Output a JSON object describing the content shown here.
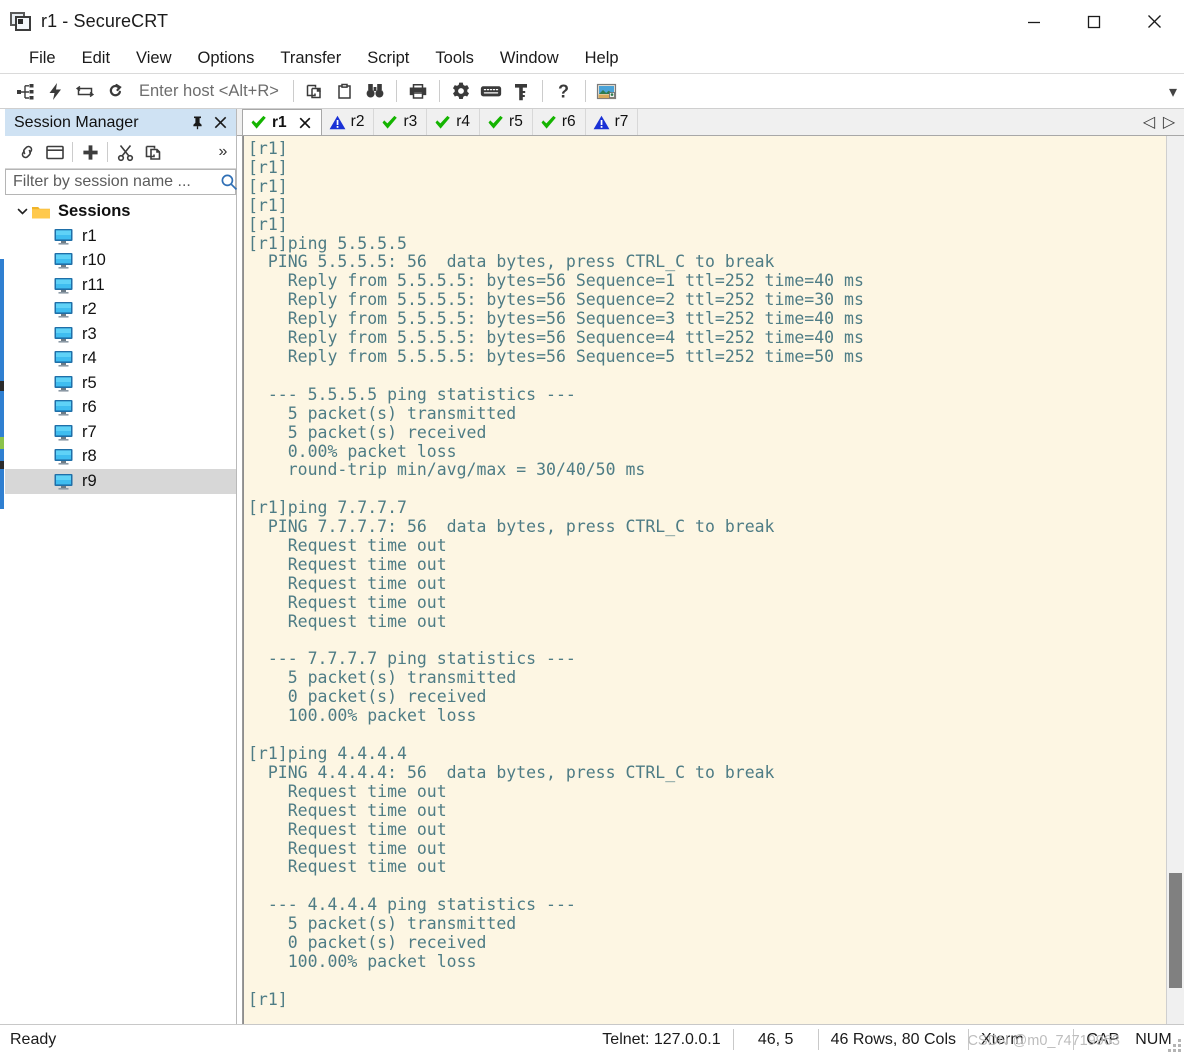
{
  "window": {
    "title": "r1 - SecureCRT",
    "app_icon": "securecrt-icon",
    "minimize_label": "Minimize",
    "maximize_label": "Maximize",
    "close_label": "Close"
  },
  "menubar": {
    "items": [
      {
        "label": "File"
      },
      {
        "label": "Edit"
      },
      {
        "label": "View"
      },
      {
        "label": "Options"
      },
      {
        "label": "Transfer"
      },
      {
        "label": "Script"
      },
      {
        "label": "Tools"
      },
      {
        "label": "Window"
      },
      {
        "label": "Help"
      }
    ]
  },
  "toolbar": {
    "host_entry": "Enter host <Alt+R>",
    "buttons": [
      {
        "name": "connect-icon",
        "title": "Connect"
      },
      {
        "name": "quick-connect-icon",
        "title": "Quick Connect"
      },
      {
        "name": "connect-in-tab-icon",
        "title": "Connect in Tab"
      },
      {
        "name": "reconnect-icon",
        "title": "Reconnect"
      },
      {
        "name": "copy-icon",
        "title": "Copy"
      },
      {
        "name": "paste-icon",
        "title": "Paste"
      },
      {
        "name": "find-icon",
        "title": "Find"
      },
      {
        "name": "print-icon",
        "title": "Print"
      },
      {
        "name": "gear-icon",
        "title": "Session Options"
      },
      {
        "name": "keyboard-icon",
        "title": "Keymap Editor"
      },
      {
        "name": "key-icon",
        "title": "Public Key"
      },
      {
        "name": "help-icon",
        "title": "Help"
      },
      {
        "name": "secure-image-icon",
        "title": "SecureFX"
      }
    ],
    "overflow_label": "▾"
  },
  "session_manager": {
    "title": "Session Manager",
    "pin_label": "⚐",
    "close_label": "✕",
    "toolbar_buttons": [
      {
        "name": "connect-session-icon",
        "title": "Connect"
      },
      {
        "name": "new-window-icon",
        "title": "Connect in New Window"
      },
      {
        "name": "new-session-icon",
        "title": "New Session"
      },
      {
        "name": "cut-icon",
        "title": "Cut"
      },
      {
        "name": "copy-session-icon",
        "title": "Copy"
      }
    ],
    "overflow_label": "»",
    "filter_placeholder": "Filter by session name ...",
    "filter_value": "",
    "tree": {
      "root_label": "Sessions",
      "root_expanded": true,
      "items": [
        {
          "label": "r1",
          "selected": false
        },
        {
          "label": "r10",
          "selected": false
        },
        {
          "label": "r11",
          "selected": false
        },
        {
          "label": "r2",
          "selected": false
        },
        {
          "label": "r3",
          "selected": false
        },
        {
          "label": "r4",
          "selected": false
        },
        {
          "label": "r5",
          "selected": false
        },
        {
          "label": "r6",
          "selected": false
        },
        {
          "label": "r7",
          "selected": false
        },
        {
          "label": "r8",
          "selected": false
        },
        {
          "label": "r9",
          "selected": true
        }
      ]
    }
  },
  "tabs": {
    "items": [
      {
        "label": "r1",
        "status": "connected",
        "icon": "green-check-icon",
        "active": true,
        "closable": true
      },
      {
        "label": "r2",
        "status": "warning",
        "icon": "blue-warning-icon",
        "active": false,
        "closable": false
      },
      {
        "label": "r3",
        "status": "connected",
        "icon": "green-check-icon",
        "active": false,
        "closable": false
      },
      {
        "label": "r4",
        "status": "connected",
        "icon": "green-check-icon",
        "active": false,
        "closable": false
      },
      {
        "label": "r5",
        "status": "connected",
        "icon": "green-check-icon",
        "active": false,
        "closable": false
      },
      {
        "label": "r6",
        "status": "connected",
        "icon": "green-check-icon",
        "active": false,
        "closable": false
      },
      {
        "label": "r7",
        "status": "warning",
        "icon": "blue-warning-icon",
        "active": false,
        "closable": false
      }
    ],
    "nav_prev": "◁",
    "nav_next": "▷"
  },
  "terminal": {
    "background_color": "#fdf6e3",
    "text_color": "#4e7c85",
    "scroll_thumb_top_pct": 83,
    "scroll_thumb_height_pct": 13,
    "lines": [
      "[r1]",
      "[r1]",
      "[r1]",
      "[r1]",
      "[r1]",
      "[r1]ping 5.5.5.5",
      "  PING 5.5.5.5: 56  data bytes, press CTRL_C to break",
      "    Reply from 5.5.5.5: bytes=56 Sequence=1 ttl=252 time=40 ms",
      "    Reply from 5.5.5.5: bytes=56 Sequence=2 ttl=252 time=30 ms",
      "    Reply from 5.5.5.5: bytes=56 Sequence=3 ttl=252 time=40 ms",
      "    Reply from 5.5.5.5: bytes=56 Sequence=4 ttl=252 time=40 ms",
      "    Reply from 5.5.5.5: bytes=56 Sequence=5 ttl=252 time=50 ms",
      "",
      "  --- 5.5.5.5 ping statistics ---",
      "    5 packet(s) transmitted",
      "    5 packet(s) received",
      "    0.00% packet loss",
      "    round-trip min/avg/max = 30/40/50 ms",
      "",
      "[r1]ping 7.7.7.7",
      "  PING 7.7.7.7: 56  data bytes, press CTRL_C to break",
      "    Request time out",
      "    Request time out",
      "    Request time out",
      "    Request time out",
      "    Request time out",
      "",
      "  --- 7.7.7.7 ping statistics ---",
      "    5 packet(s) transmitted",
      "    0 packet(s) received",
      "    100.00% packet loss",
      "",
      "[r1]ping 4.4.4.4",
      "  PING 4.4.4.4: 56  data bytes, press CTRL_C to break",
      "    Request time out",
      "    Request time out",
      "    Request time out",
      "    Request time out",
      "    Request time out",
      "",
      "  --- 4.4.4.4 ping statistics ---",
      "    5 packet(s) transmitted",
      "    0 packet(s) received",
      "    100.00% packet loss",
      "",
      "[r1]"
    ]
  },
  "statusbar": {
    "ready": "Ready",
    "connection": "Telnet: 127.0.0.1",
    "cursor_position": "46,  5",
    "screen_size": "46 Rows, 80 Cols",
    "emulation": "Xterm",
    "caps": "CAP",
    "num": "NUM",
    "watermark": "CSDN @m0_74719963"
  }
}
